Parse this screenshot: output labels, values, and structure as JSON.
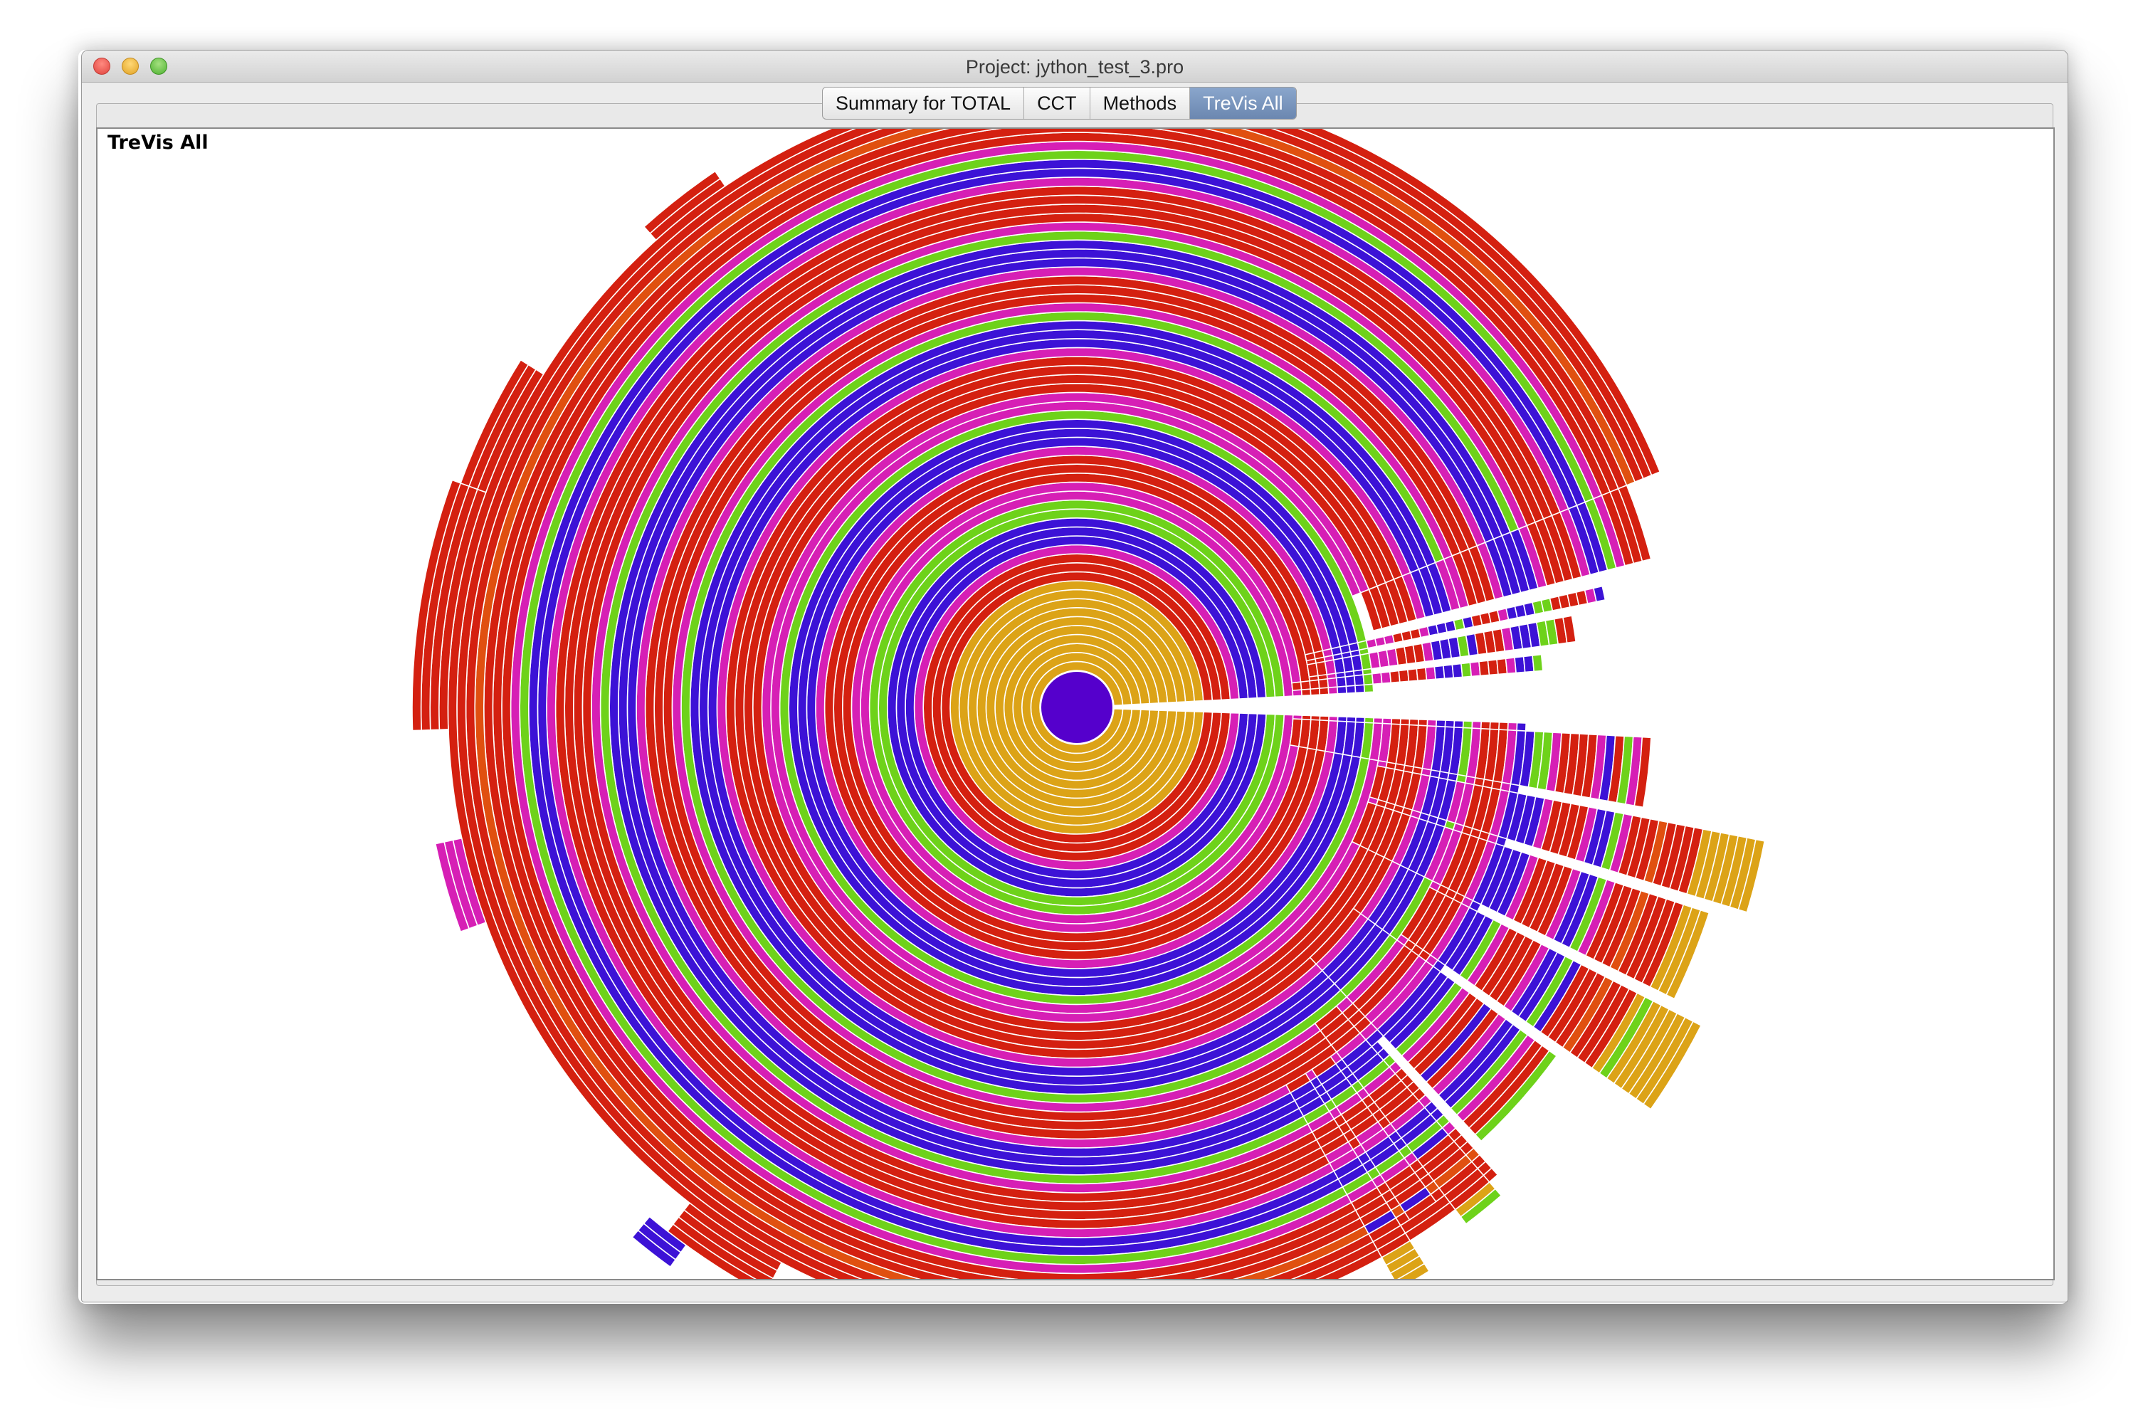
{
  "window": {
    "title": "Project: jython_test_3.pro"
  },
  "tabs": [
    {
      "label": "Summary for TOTAL",
      "active": false
    },
    {
      "label": "CCT",
      "active": false
    },
    {
      "label": "Methods",
      "active": false
    },
    {
      "label": "TreVis All",
      "active": true
    }
  ],
  "panel": {
    "title": "TreVis All"
  },
  "colors": {
    "center": "#5500cc",
    "gold": "#dca317",
    "red": "#d42010",
    "magenta": "#d61fb5",
    "green": "#6ed21a",
    "blue": "#3c12d6",
    "orange": "#e05010",
    "teal": "#3ad2a8",
    "gap": "#ffffff"
  },
  "visualization": {
    "type": "sunburst",
    "ring_color_sequence": [
      "gold",
      "gold",
      "gold",
      "gold",
      "gold",
      "gold",
      "gold",
      "gold",
      "gold",
      "gold",
      "red",
      "red",
      "red",
      "magenta",
      "blue",
      "blue",
      "blue",
      "green",
      "green",
      "magenta",
      "magenta",
      "red",
      "red",
      "red",
      "magenta",
      "blue",
      "blue",
      "blue",
      "green",
      "magenta",
      "magenta",
      "red",
      "red",
      "red",
      "red",
      "magenta",
      "blue",
      "blue",
      "blue",
      "green",
      "magenta",
      "red",
      "red",
      "red",
      "magenta",
      "blue",
      "blue",
      "blue",
      "green",
      "magenta",
      "red",
      "red",
      "red",
      "red",
      "magenta",
      "blue",
      "blue",
      "green",
      "magenta",
      "red",
      "red",
      "red",
      "orange",
      "red",
      "red",
      "red"
    ]
  }
}
